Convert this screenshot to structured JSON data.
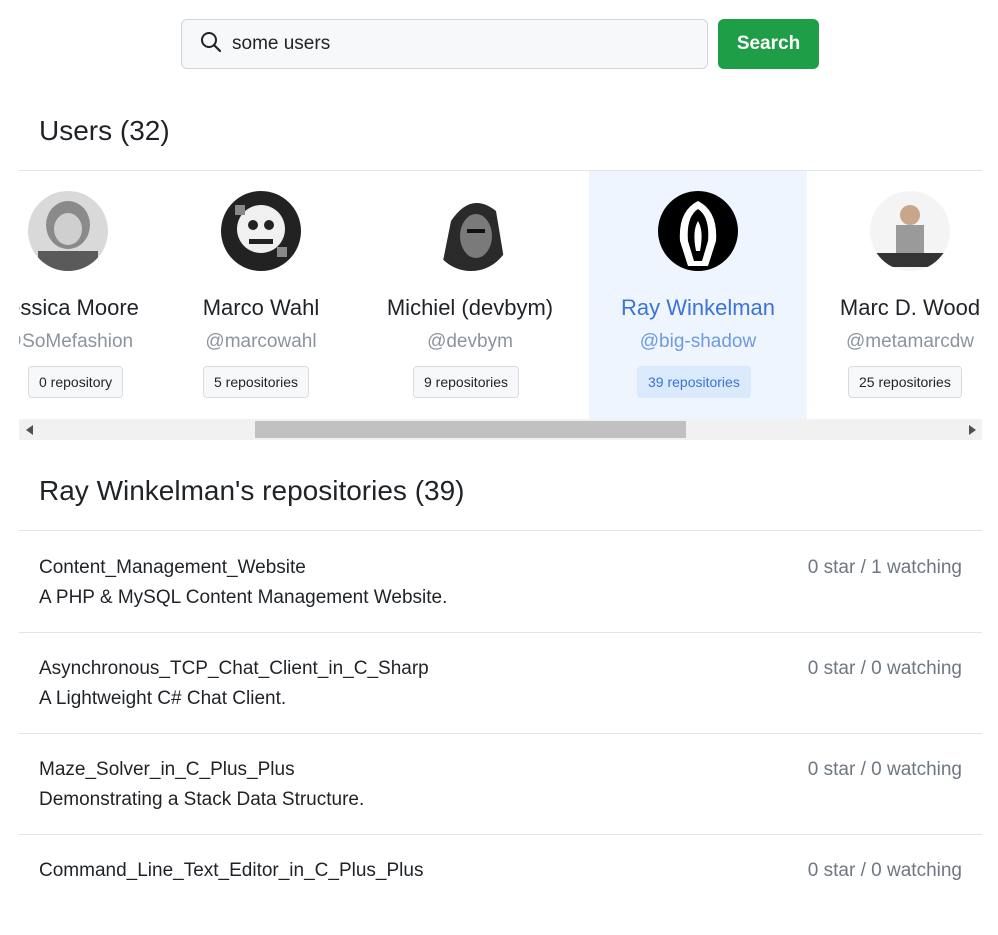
{
  "search": {
    "value": "some users",
    "button_label": "Search"
  },
  "users_section": {
    "title": "Users (32)"
  },
  "users": [
    {
      "name": "Jessica Moore",
      "handle": "@SoMefashion",
      "repos": "0 repository",
      "selected": false
    },
    {
      "name": "Marco Wahl",
      "handle": "@marcowahl",
      "repos": "5 repositories",
      "selected": false
    },
    {
      "name": "Michiel (devbym)",
      "handle": "@devbym",
      "repos": "9 repositories",
      "selected": false
    },
    {
      "name": "Ray Winkelman",
      "handle": "@big-shadow",
      "repos": "39 repositories",
      "selected": true
    },
    {
      "name": "Marc D. Wood",
      "handle": "@metamarcdw",
      "repos": "25 repositories",
      "selected": false
    }
  ],
  "repos_section": {
    "title": "Ray Winkelman's repositories (39)"
  },
  "repos": [
    {
      "name": "Content_Management_Website",
      "desc": "A PHP & MySQL Content Management Website.",
      "stats": "0 star / 1 watching"
    },
    {
      "name": "Asynchronous_TCP_Chat_Client_in_C_Sharp",
      "desc": "A Lightweight C# Chat Client.",
      "stats": "0 star / 0 watching"
    },
    {
      "name": "Maze_Solver_in_C_Plus_Plus",
      "desc": "Demonstrating a Stack Data Structure.",
      "stats": "0 star / 0 watching"
    },
    {
      "name": "Command_Line_Text_Editor_in_C_Plus_Plus",
      "desc": "",
      "stats": "0 star / 0 watching"
    }
  ],
  "icons": {
    "search": "search-icon",
    "scroll_left": "arrow-left-icon",
    "scroll_right": "arrow-right-icon"
  },
  "colors": {
    "accent": "#1f9e48",
    "selected_bg": "#eef5ff",
    "selected_text": "#3b73d6"
  }
}
